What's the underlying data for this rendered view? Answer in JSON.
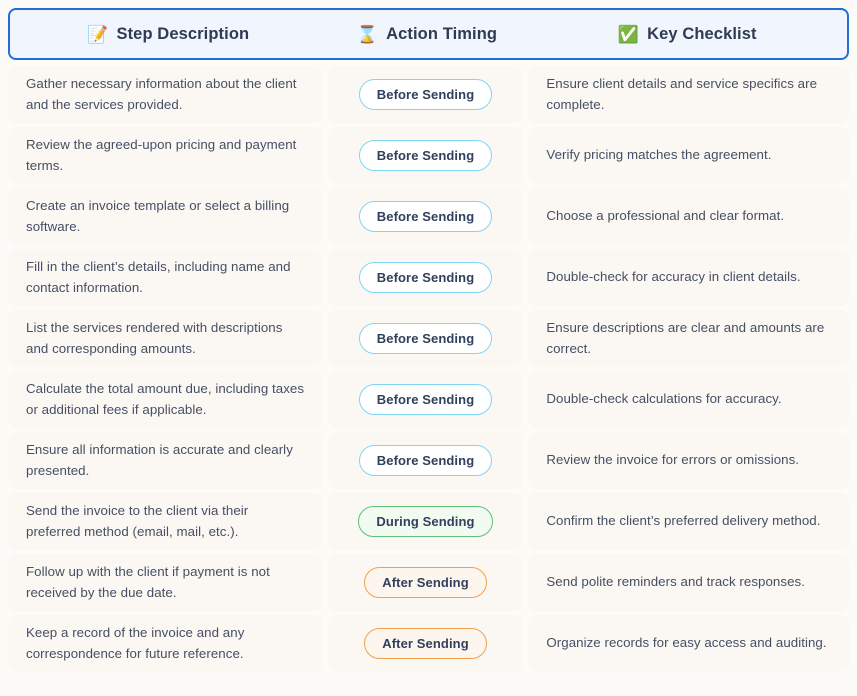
{
  "header": {
    "columns": [
      {
        "icon": "memo-icon",
        "glyph": "📝",
        "label": "Step Description"
      },
      {
        "icon": "hourglass-icon",
        "glyph": "⌛",
        "label": "Action Timing"
      },
      {
        "icon": "check-mark-button-icon",
        "glyph": "✅",
        "label": "Key Checklist"
      }
    ],
    "border_color": "#1f6fd4",
    "background_color": "#f1f6fe"
  },
  "colors": {
    "page_background": "#fdfbf7",
    "cell_background": "#fbf8f4",
    "text": "#454f63",
    "header_text": "#2f3b52",
    "badge_before_border": "#7fd6f2",
    "badge_during_border": "#5ec075",
    "badge_after_border": "#f2a04b"
  },
  "rows": [
    {
      "step": "Gather necessary information about the client and the services provided.",
      "timing": "Before Sending",
      "timing_variant": "before",
      "checklist": "Ensure client details and service specifics are complete."
    },
    {
      "step": "Review the agreed-upon pricing and payment terms.",
      "timing": "Before Sending",
      "timing_variant": "before",
      "checklist": "Verify pricing matches the agreement."
    },
    {
      "step": "Create an invoice template or select a billing software.",
      "timing": "Before Sending",
      "timing_variant": "before",
      "checklist": "Choose a professional and clear format."
    },
    {
      "step": "Fill in the client’s details, including name and contact information.",
      "timing": "Before Sending",
      "timing_variant": "before",
      "checklist": "Double-check for accuracy in client details."
    },
    {
      "step": "List the services rendered with descriptions and corresponding amounts.",
      "timing": "Before Sending",
      "timing_variant": "before",
      "checklist": "Ensure descriptions are clear and amounts are correct."
    },
    {
      "step": "Calculate the total amount due, including taxes or additional fees if applicable.",
      "timing": "Before Sending",
      "timing_variant": "before",
      "checklist": "Double-check calculations for accuracy."
    },
    {
      "step": "Ensure all information is accurate and clearly presented.",
      "timing": "Before Sending",
      "timing_variant": "before",
      "checklist": "Review the invoice for errors or omissions."
    },
    {
      "step": "Send the invoice to the client via their preferred method (email, mail, etc.).",
      "timing": "During Sending",
      "timing_variant": "during",
      "checklist": "Confirm the client’s preferred delivery method."
    },
    {
      "step": "Follow up with the client if payment is not received by the due date.",
      "timing": "After Sending",
      "timing_variant": "after",
      "checklist": "Send polite reminders and track responses."
    },
    {
      "step": "Keep a record of the invoice and any correspondence for future reference.",
      "timing": "After Sending",
      "timing_variant": "after",
      "checklist": "Organize records for easy access and auditing."
    }
  ]
}
